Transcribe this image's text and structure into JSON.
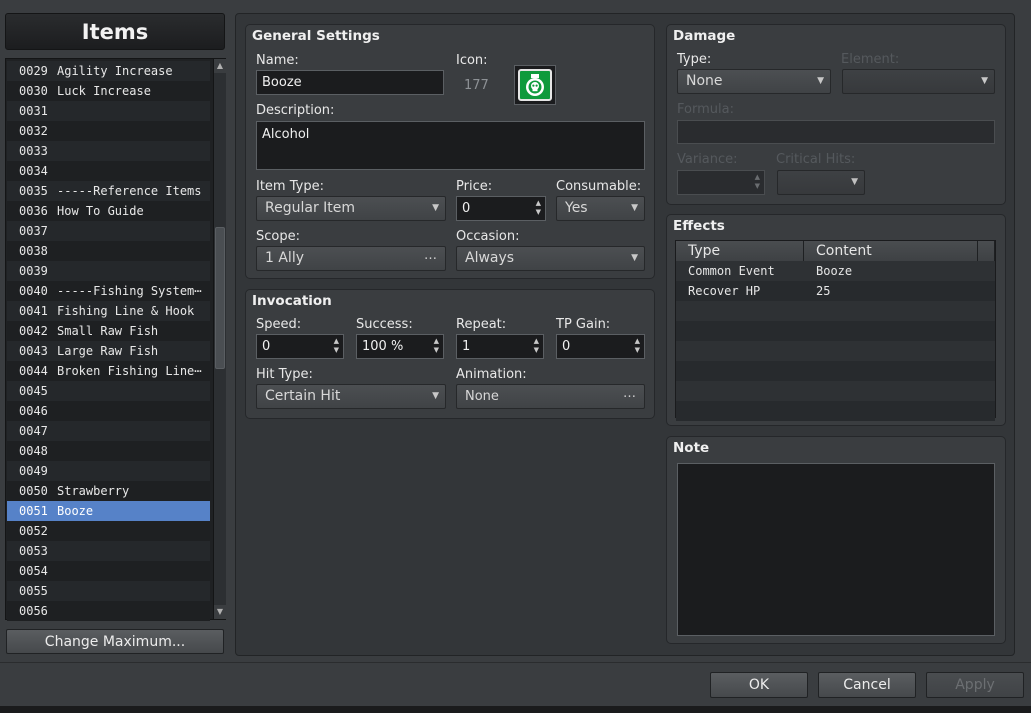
{
  "sidebar": {
    "title": "Items",
    "items": [
      {
        "id": "0029",
        "name": "Agility Increase"
      },
      {
        "id": "0030",
        "name": "Luck Increase"
      },
      {
        "id": "0031",
        "name": ""
      },
      {
        "id": "0032",
        "name": ""
      },
      {
        "id": "0033",
        "name": ""
      },
      {
        "id": "0034",
        "name": ""
      },
      {
        "id": "0035",
        "name": "-----Reference Items"
      },
      {
        "id": "0036",
        "name": "How To Guide"
      },
      {
        "id": "0037",
        "name": ""
      },
      {
        "id": "0038",
        "name": ""
      },
      {
        "id": "0039",
        "name": ""
      },
      {
        "id": "0040",
        "name": "-----Fishing System⋯"
      },
      {
        "id": "0041",
        "name": "Fishing Line & Hook"
      },
      {
        "id": "0042",
        "name": "Small Raw Fish"
      },
      {
        "id": "0043",
        "name": "Large Raw Fish"
      },
      {
        "id": "0044",
        "name": "Broken Fishing Line⋯"
      },
      {
        "id": "0045",
        "name": ""
      },
      {
        "id": "0046",
        "name": ""
      },
      {
        "id": "0047",
        "name": ""
      },
      {
        "id": "0048",
        "name": ""
      },
      {
        "id": "0049",
        "name": ""
      },
      {
        "id": "0050",
        "name": "Strawberry"
      },
      {
        "id": "0051",
        "name": "Booze",
        "selected": true
      },
      {
        "id": "0052",
        "name": ""
      },
      {
        "id": "0053",
        "name": ""
      },
      {
        "id": "0054",
        "name": ""
      },
      {
        "id": "0055",
        "name": ""
      },
      {
        "id": "0056",
        "name": ""
      }
    ],
    "change_max_label": "Change Maximum..."
  },
  "general": {
    "title": "General Settings",
    "name_label": "Name:",
    "name_value": "Booze",
    "icon_label": "Icon:",
    "icon_index": "177",
    "description_label": "Description:",
    "description_value": "Alcohol",
    "item_type_label": "Item Type:",
    "item_type_value": "Regular Item",
    "price_label": "Price:",
    "price_value": "0",
    "consumable_label": "Consumable:",
    "consumable_value": "Yes",
    "scope_label": "Scope:",
    "scope_value": "1 Ally",
    "occasion_label": "Occasion:",
    "occasion_value": "Always"
  },
  "invocation": {
    "title": "Invocation",
    "speed_label": "Speed:",
    "speed_value": "0",
    "success_label": "Success:",
    "success_value": "100 %",
    "repeat_label": "Repeat:",
    "repeat_value": "1",
    "tp_gain_label": "TP Gain:",
    "tp_gain_value": "0",
    "hit_type_label": "Hit Type:",
    "hit_type_value": "Certain Hit",
    "animation_label": "Animation:",
    "animation_value": "None"
  },
  "damage": {
    "title": "Damage",
    "type_label": "Type:",
    "type_value": "None",
    "element_label": "Element:",
    "formula_label": "Formula:",
    "variance_label": "Variance:",
    "critical_label": "Critical Hits:"
  },
  "effects": {
    "title": "Effects",
    "columns": [
      "Type",
      "Content"
    ],
    "rows": [
      {
        "type": "Common Event",
        "content": "Booze"
      },
      {
        "type": "Recover HP",
        "content": "25"
      },
      {
        "type": "",
        "content": ""
      },
      {
        "type": "",
        "content": ""
      },
      {
        "type": "",
        "content": ""
      },
      {
        "type": "",
        "content": ""
      },
      {
        "type": "",
        "content": ""
      },
      {
        "type": "",
        "content": ""
      }
    ]
  },
  "note": {
    "title": "Note"
  },
  "footer": {
    "ok": "OK",
    "cancel": "Cancel",
    "apply": "Apply"
  },
  "colors": {
    "selection": "#5682c8",
    "icon_bg": "#0e9a3c"
  },
  "icons": {
    "item_icon": "skull-potion-icon"
  }
}
